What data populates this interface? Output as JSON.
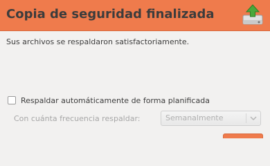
{
  "dialog": {
    "title": "Copia de seguridad finalizada",
    "header_icon": "backup-drive-icon",
    "message": "Sus archivos se respaldaron satisfactoriamente."
  },
  "schedule": {
    "checkbox_label": "Respaldar automáticamente de forma planificada",
    "checkbox_checked": false,
    "frequency_label": "Con cuánta frecuencia respaldar:",
    "frequency_value": "Semanalmente",
    "frequency_enabled": false
  },
  "colors": {
    "header": "#ef7b4c",
    "accent_green": "#4aa83a",
    "text": "#3c3c3c",
    "disabled_text": "#a7a7a7",
    "window_bg": "#f2f1f0"
  }
}
